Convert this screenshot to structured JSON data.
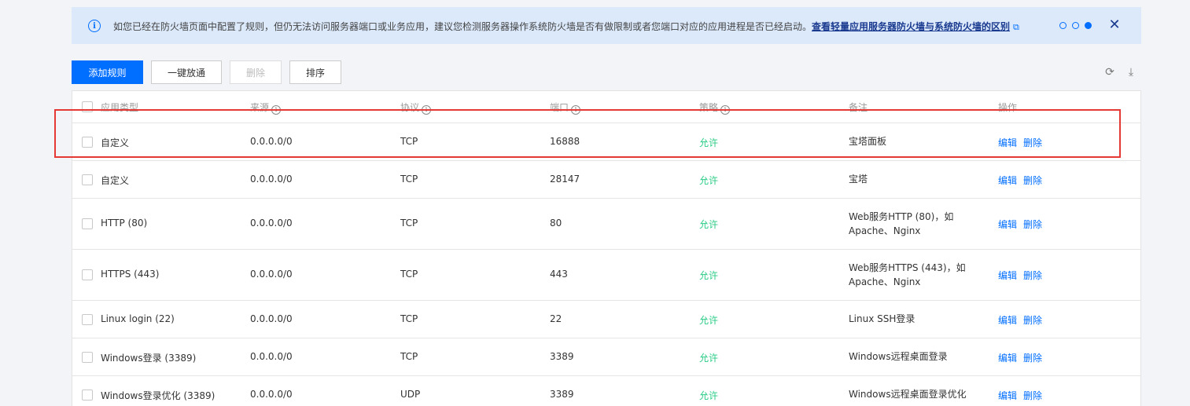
{
  "notice": {
    "text": "如您已经在防火墙页面中配置了规则，但仍无法访问服务器端口或业务应用，建议您检测服务器操作系统防火墙是否有做限制或者您端口对应的应用进程是否已经启动。",
    "link": "查看轻量应用服务器防火墙与系统防火墙的区别"
  },
  "toolbar": {
    "add_rule": "添加规则",
    "one_click": "一键放通",
    "delete": "删除",
    "sort": "排序"
  },
  "columns": {
    "type": "应用类型",
    "source": "来源",
    "protocol": "协议",
    "port": "端口",
    "policy": "策略",
    "note": "备注",
    "operation": "操作"
  },
  "rows": [
    {
      "type": "自定义",
      "source": "0.0.0.0/0",
      "protocol": "TCP",
      "port": "16888",
      "policy": "允许",
      "note1": "宝塔面板",
      "note2": "",
      "edit": "编辑",
      "delete": "删除"
    },
    {
      "type": "自定义",
      "source": "0.0.0.0/0",
      "protocol": "TCP",
      "port": "28147",
      "policy": "允许",
      "note1": "宝塔",
      "note2": "",
      "edit": "编辑",
      "delete": "删除"
    },
    {
      "type": "HTTP (80)",
      "source": "0.0.0.0/0",
      "protocol": "TCP",
      "port": "80",
      "policy": "允许",
      "note1": "Web服务HTTP (80)，如",
      "note2": "Apache、Nginx",
      "edit": "编辑",
      "delete": "删除"
    },
    {
      "type": "HTTPS (443)",
      "source": "0.0.0.0/0",
      "protocol": "TCP",
      "port": "443",
      "policy": "允许",
      "note1": "Web服务HTTPS (443)，如",
      "note2": "Apache、Nginx",
      "edit": "编辑",
      "delete": "删除"
    },
    {
      "type": "Linux login (22)",
      "source": "0.0.0.0/0",
      "protocol": "TCP",
      "port": "22",
      "policy": "允许",
      "note1": "Linux SSH登录",
      "note2": "",
      "edit": "编辑",
      "delete": "删除"
    },
    {
      "type": "Windows登录 (3389)",
      "source": "0.0.0.0/0",
      "protocol": "TCP",
      "port": "3389",
      "policy": "允许",
      "note1": "Windows远程桌面登录",
      "note2": "",
      "edit": "编辑",
      "delete": "删除"
    },
    {
      "type": "Windows登录优化 (3389)",
      "source": "0.0.0.0/0",
      "protocol": "UDP",
      "port": "3389",
      "policy": "允许",
      "note1": "Windows远程桌面登录优化",
      "note2": "",
      "edit": "编辑",
      "delete": "删除"
    }
  ],
  "icons": {
    "info": "info-icon",
    "external": "external-link-icon",
    "close": "close-icon",
    "refresh": "refresh-icon",
    "download": "download-icon",
    "help": "question-icon"
  },
  "colors": {
    "primary": "#006eff",
    "allow": "#29cc85",
    "highlight": "#e53935"
  }
}
